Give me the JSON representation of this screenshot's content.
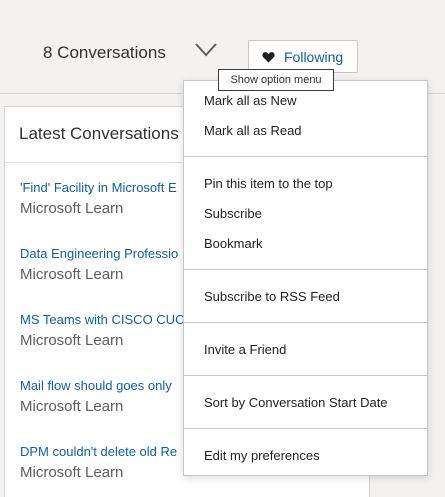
{
  "header": {
    "conversation_count": "8 Conversations",
    "follow_label": "Following"
  },
  "tooltip": {
    "text": "Show option menu"
  },
  "panel": {
    "title": "Latest Conversations",
    "items": [
      {
        "title": "'Find' Facility in Microsoft E",
        "source": "Microsoft Learn"
      },
      {
        "title": "Data Engineering Professio",
        "source": "Microsoft Learn"
      },
      {
        "title": "MS Teams with CISCO CUC",
        "source": "Microsoft Learn"
      },
      {
        "title": "Mail flow should goes only",
        "source": "Microsoft Learn"
      },
      {
        "title": "DPM couldn't delete old Re",
        "source": "Microsoft Learn"
      }
    ]
  },
  "menu": {
    "items": [
      {
        "label": "Mark all as New"
      },
      {
        "label": "Mark all as Read"
      },
      {
        "label": "Pin this item to the top"
      },
      {
        "label": "Subscribe"
      },
      {
        "label": "Bookmark"
      },
      {
        "label": "Subscribe to RSS Feed"
      },
      {
        "label": "Invite a Friend"
      },
      {
        "label": "Sort by Conversation Start Date"
      },
      {
        "label": "Edit my preferences"
      }
    ]
  },
  "colors": {
    "link": "#0f5fa8",
    "text": "#323130",
    "muted": "#605e5c",
    "background": "#f3f2f1"
  },
  "icons": {
    "chevron": "chevron-down-icon",
    "heart": "heart-icon"
  }
}
